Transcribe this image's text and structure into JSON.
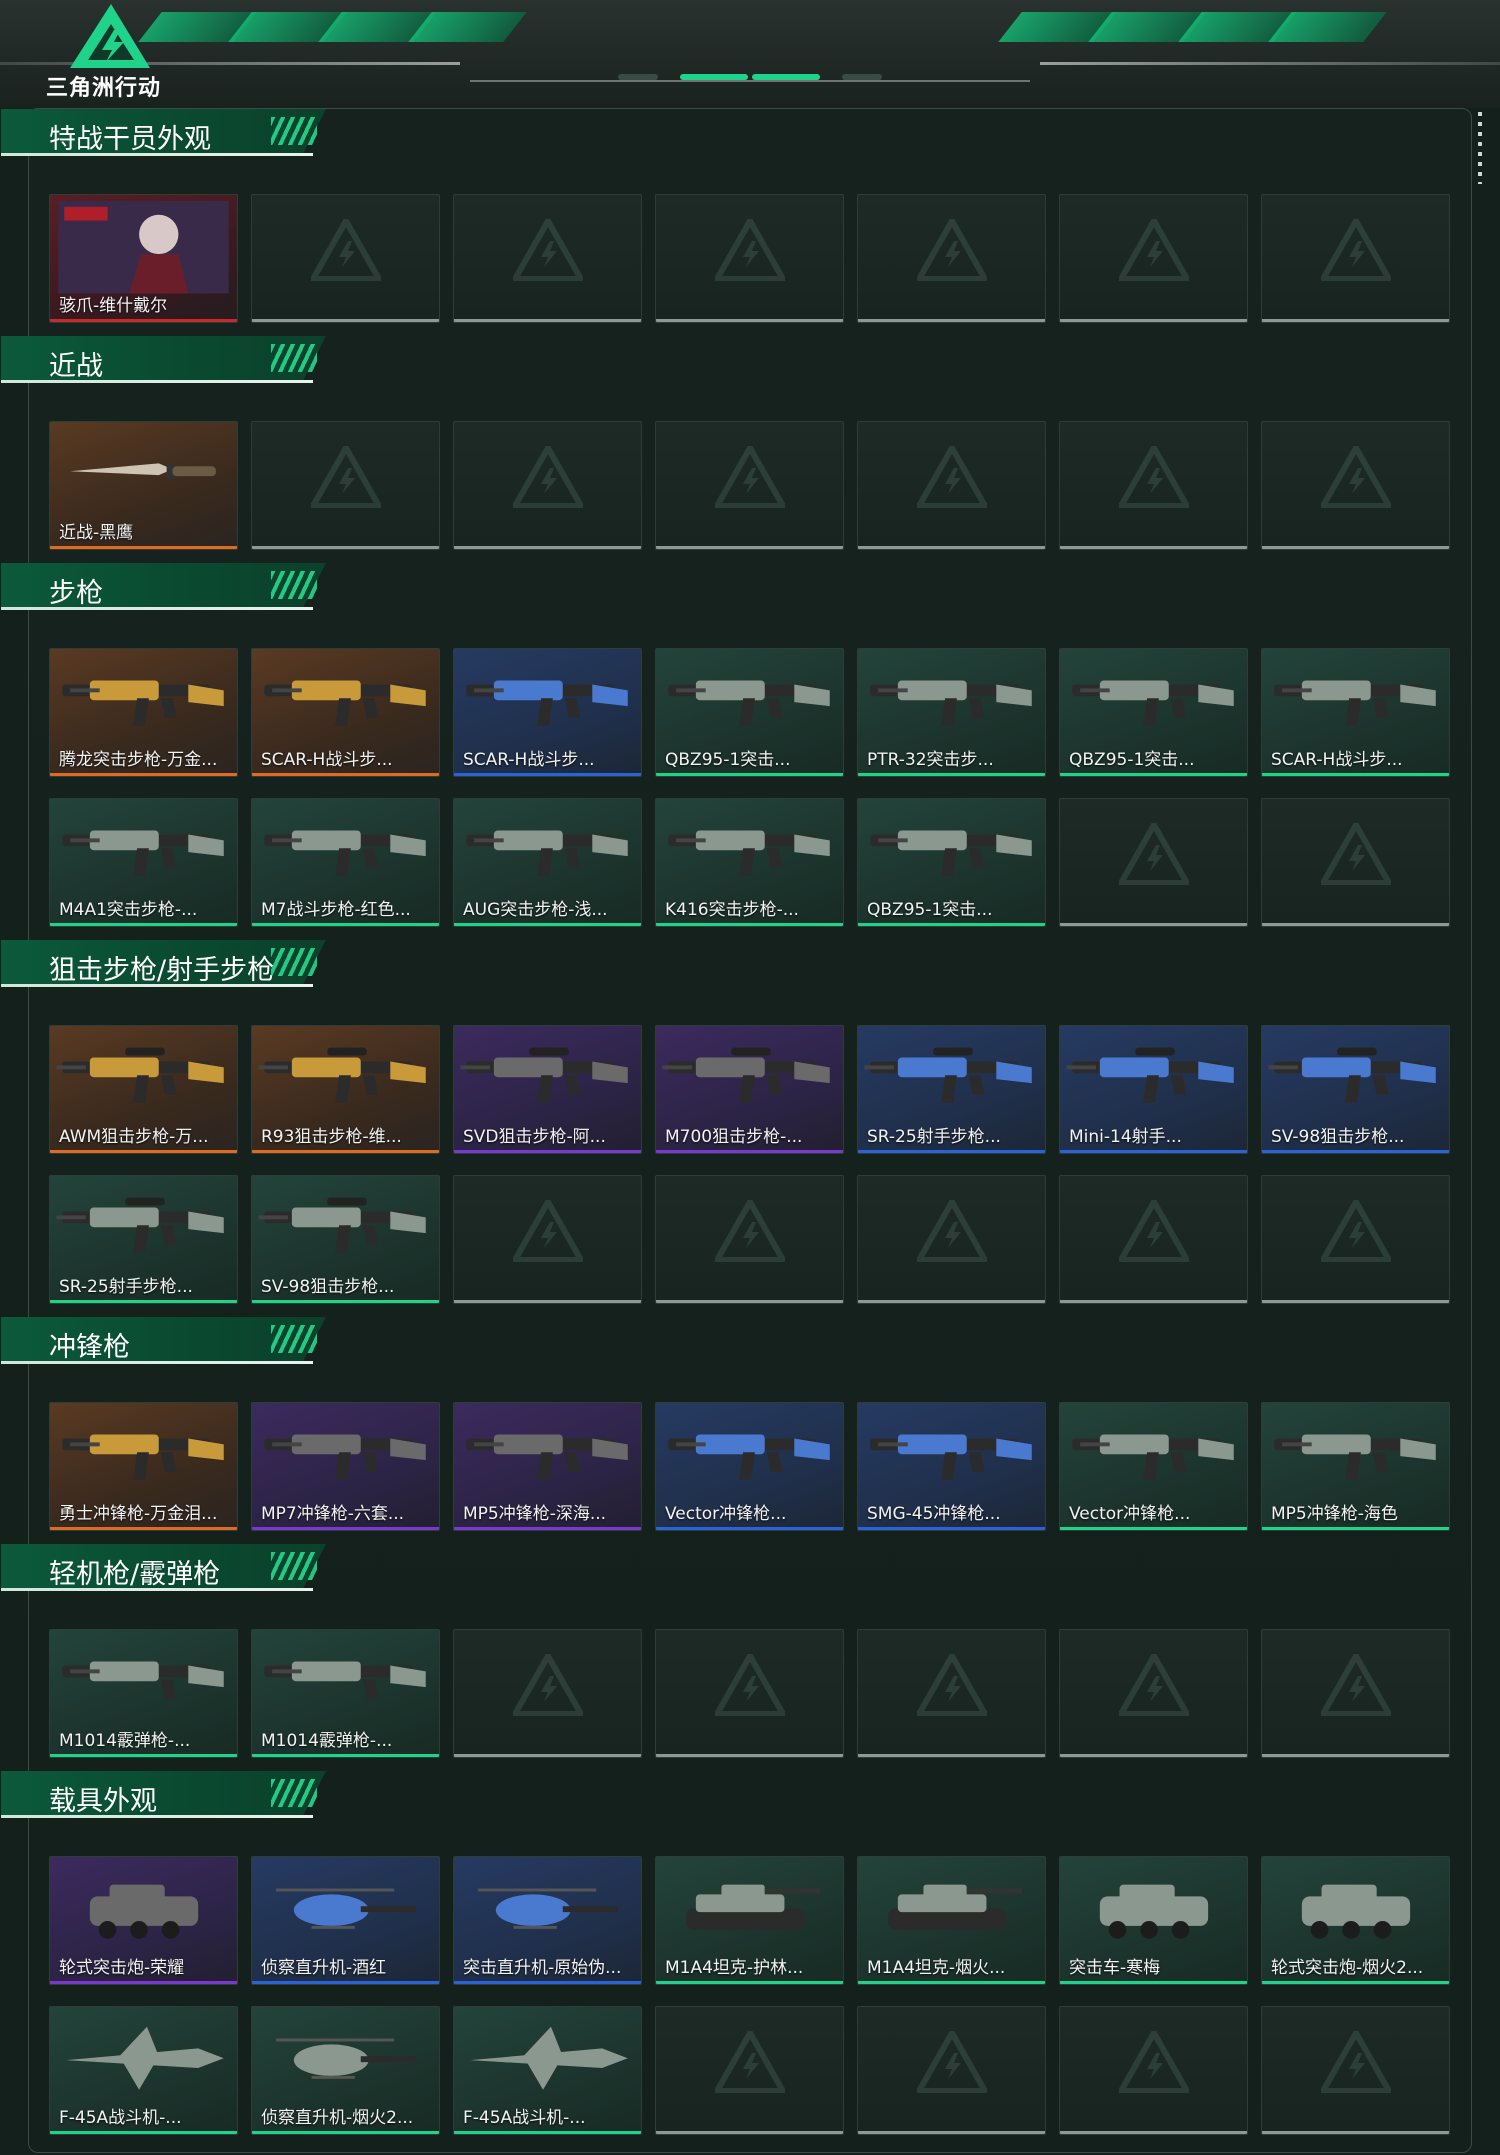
{
  "app": {
    "logo_text": "三角洲行动"
  },
  "colors": {
    "gold": "#e06a20",
    "red": "#c8282e",
    "purple": "#7a38d0",
    "blue": "#2a62d8",
    "green": "#1fd38a",
    "empty": "#8e9894"
  },
  "categories": [
    {
      "title": "特战干员外观",
      "items": [
        {
          "name": "骇爪-维什戴尔",
          "rarity": "red",
          "icon": "operator-portrait"
        }
      ]
    },
    {
      "title": "近战",
      "items": [
        {
          "name": "近战-黑鹰",
          "rarity": "gold",
          "icon": "knife"
        }
      ]
    },
    {
      "title": "步枪",
      "items": [
        {
          "name": "腾龙突击步枪-万金...",
          "rarity": "gold",
          "icon": "rifle"
        },
        {
          "name": "SCAR-H战斗步...",
          "rarity": "gold",
          "icon": "rifle"
        },
        {
          "name": "SCAR-H战斗步...",
          "rarity": "blue",
          "icon": "rifle"
        },
        {
          "name": "QBZ95-1突击...",
          "rarity": "green",
          "icon": "rifle"
        },
        {
          "name": "PTR-32突击步...",
          "rarity": "green",
          "icon": "rifle"
        },
        {
          "name": "QBZ95-1突击...",
          "rarity": "green",
          "icon": "rifle"
        },
        {
          "name": "SCAR-H战斗步...",
          "rarity": "green",
          "icon": "rifle"
        },
        {
          "name": "M4A1突击步枪-...",
          "rarity": "green",
          "icon": "rifle"
        },
        {
          "name": "M7战斗步枪-红色...",
          "rarity": "green",
          "icon": "rifle"
        },
        {
          "name": "AUG突击步枪-浅...",
          "rarity": "green",
          "icon": "rifle"
        },
        {
          "name": "K416突击步枪-...",
          "rarity": "green",
          "icon": "rifle"
        },
        {
          "name": "QBZ95-1突击...",
          "rarity": "green",
          "icon": "rifle"
        }
      ]
    },
    {
      "title": "狙击步枪/射手步枪",
      "items": [
        {
          "name": "AWM狙击步枪-万...",
          "rarity": "gold",
          "icon": "sniper-rifle"
        },
        {
          "name": "R93狙击步枪-维...",
          "rarity": "gold",
          "icon": "sniper-rifle"
        },
        {
          "name": "SVD狙击步枪-阿...",
          "rarity": "purple",
          "icon": "sniper-rifle"
        },
        {
          "name": "M700狙击步枪-...",
          "rarity": "purple",
          "icon": "sniper-rifle"
        },
        {
          "name": "SR-25射手步枪...",
          "rarity": "blue",
          "icon": "sniper-rifle"
        },
        {
          "name": "Mini-14射手...",
          "rarity": "blue",
          "icon": "sniper-rifle"
        },
        {
          "name": "SV-98狙击步枪...",
          "rarity": "blue",
          "icon": "sniper-rifle"
        },
        {
          "name": "SR-25射手步枪...",
          "rarity": "green",
          "icon": "sniper-rifle"
        },
        {
          "name": "SV-98狙击步枪...",
          "rarity": "green",
          "icon": "sniper-rifle"
        }
      ]
    },
    {
      "title": "冲锋枪",
      "items": [
        {
          "name": "勇士冲锋枪-万金泪...",
          "rarity": "gold",
          "icon": "smg"
        },
        {
          "name": "MP7冲锋枪-六套...",
          "rarity": "purple",
          "icon": "smg"
        },
        {
          "name": "MP5冲锋枪-深海...",
          "rarity": "purple",
          "icon": "smg"
        },
        {
          "name": "Vector冲锋枪...",
          "rarity": "blue",
          "icon": "smg"
        },
        {
          "name": "SMG-45冲锋枪...",
          "rarity": "blue",
          "icon": "smg"
        },
        {
          "name": "Vector冲锋枪...",
          "rarity": "green",
          "icon": "smg"
        },
        {
          "name": "MP5冲锋枪-海色",
          "rarity": "green",
          "icon": "smg"
        }
      ]
    },
    {
      "title": "轻机枪/霰弹枪",
      "items": [
        {
          "name": "M1014霰弹枪-...",
          "rarity": "green",
          "icon": "shotgun"
        },
        {
          "name": "M1014霰弹枪-...",
          "rarity": "green",
          "icon": "shotgun"
        }
      ]
    },
    {
      "title": "载具外观",
      "items": [
        {
          "name": "轮式突击炮-荣耀",
          "rarity": "purple",
          "icon": "vehicle"
        },
        {
          "name": "侦察直升机-酒红",
          "rarity": "blue",
          "icon": "helicopter"
        },
        {
          "name": "突击直升机-原始伪...",
          "rarity": "blue",
          "icon": "helicopter"
        },
        {
          "name": "M1A4坦克-护林...",
          "rarity": "green",
          "icon": "tank"
        },
        {
          "name": "M1A4坦克-烟火...",
          "rarity": "green",
          "icon": "tank"
        },
        {
          "name": "突击车-寒梅",
          "rarity": "green",
          "icon": "vehicle"
        },
        {
          "name": "轮式突击炮-烟火2...",
          "rarity": "green",
          "icon": "vehicle"
        },
        {
          "name": "F-45A战斗机-...",
          "rarity": "green",
          "icon": "jet"
        },
        {
          "name": "侦察直升机-烟火2...",
          "rarity": "green",
          "icon": "helicopter"
        },
        {
          "name": "F-45A战斗机-...",
          "rarity": "green",
          "icon": "jet"
        }
      ]
    }
  ]
}
